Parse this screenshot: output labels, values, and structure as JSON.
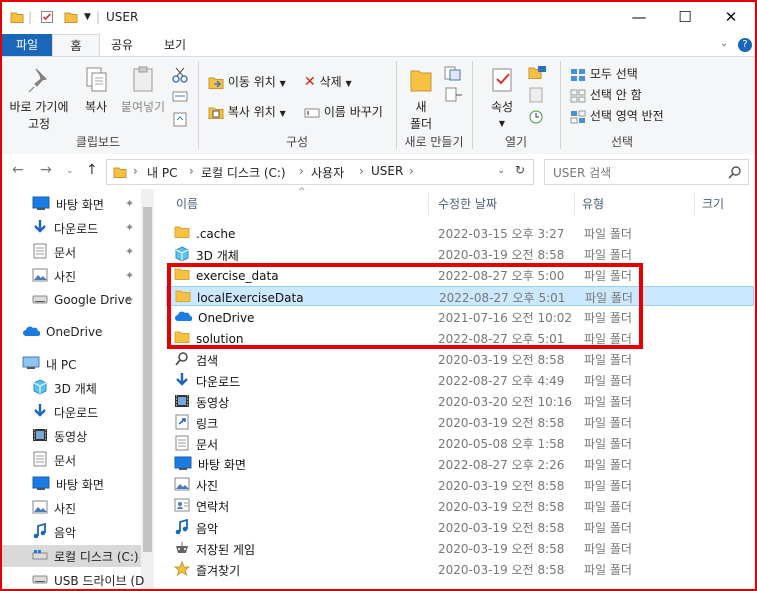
{
  "window": {
    "title": "USER",
    "controls": {
      "minimize": "—",
      "maximize": "☐",
      "close": "✕"
    }
  },
  "ribbon_tabs": [
    "파일",
    "홈",
    "공유",
    "보기"
  ],
  "ribbon": {
    "clipboard": {
      "pin_label_1": "바로 가기에",
      "pin_label_2": "고정",
      "copy": "복사",
      "paste": "붙여넣기",
      "label": "클립보드"
    },
    "organize": {
      "move_to": "이동 위치",
      "copy_to": "복사 위치",
      "delete": "삭제",
      "rename": "이름 바꾸기",
      "label": "구성"
    },
    "new": {
      "new_folder_1": "새",
      "new_folder_2": "폴더",
      "label": "새로 만들기"
    },
    "open": {
      "properties": "속성",
      "label": "열기"
    },
    "select": {
      "select_all": "모두 선택",
      "select_none": "선택 안 함",
      "invert": "선택 영역 반전",
      "label": "선택"
    }
  },
  "address": {
    "breadcrumb": [
      "내 PC",
      "로컬 디스크 (C:)",
      "사용자",
      "USER"
    ],
    "search_placeholder": "USER 검색"
  },
  "nav_pane": [
    {
      "label": "바탕 화면",
      "icon": "desktop-icon",
      "pinned": true
    },
    {
      "label": "다운로드",
      "icon": "download-icon",
      "pinned": true
    },
    {
      "label": "문서",
      "icon": "document-icon",
      "pinned": true
    },
    {
      "label": "사진",
      "icon": "pictures-icon",
      "pinned": true
    },
    {
      "label": "Google Drive",
      "icon": "drive-icon",
      "pinned": true
    },
    {
      "label": "OneDrive",
      "icon": "onedrive-icon",
      "pinned": false
    },
    {
      "label": "내 PC",
      "icon": "pc-icon",
      "pinned": false
    },
    {
      "label": "3D 개체",
      "icon": "3d-icon",
      "pinned": false
    },
    {
      "label": "다운로드",
      "icon": "download-icon",
      "pinned": false
    },
    {
      "label": "동영상",
      "icon": "video-icon",
      "pinned": false
    },
    {
      "label": "문서",
      "icon": "document-icon",
      "pinned": false
    },
    {
      "label": "바탕 화면",
      "icon": "desktop-icon",
      "pinned": false
    },
    {
      "label": "사진",
      "icon": "pictures-icon",
      "pinned": false
    },
    {
      "label": "음악",
      "icon": "music-icon",
      "pinned": false
    },
    {
      "label": "로컬 디스크 (C:)",
      "icon": "disk-icon",
      "pinned": false
    },
    {
      "label": "USB 드라이브 (D",
      "icon": "usb-icon",
      "pinned": false
    }
  ],
  "columns": [
    "이름",
    "수정한 날짜",
    "유형",
    "크기"
  ],
  "files": [
    {
      "name": ".cache",
      "date": "2022-03-15 오후 3:27",
      "type": "파일 폴더",
      "icon": "folder-icon"
    },
    {
      "name": "3D 개체",
      "date": "2020-03-19 오전 8:58",
      "type": "파일 폴더",
      "icon": "3d-icon"
    },
    {
      "name": "exercise_data",
      "date": "2022-08-27 오후 5:00",
      "type": "파일 폴더",
      "icon": "folder-icon"
    },
    {
      "name": "localExerciseData",
      "date": "2022-08-27 오후 5:01",
      "type": "파일 폴더",
      "icon": "folder-icon"
    },
    {
      "name": "OneDrive",
      "date": "2021-07-16 오전 10:02",
      "type": "파일 폴더",
      "icon": "onedrive-icon"
    },
    {
      "name": "solution",
      "date": "2022-08-27 오후 5:01",
      "type": "파일 폴더",
      "icon": "folder-icon"
    },
    {
      "name": "검색",
      "date": "2020-03-19 오전 8:58",
      "type": "파일 폴더",
      "icon": "search-icon"
    },
    {
      "name": "다운로드",
      "date": "2022-08-27 오후 4:49",
      "type": "파일 폴더",
      "icon": "download-icon"
    },
    {
      "name": "동영상",
      "date": "2020-03-20 오전 10:16",
      "type": "파일 폴더",
      "icon": "video-icon"
    },
    {
      "name": "링크",
      "date": "2020-03-19 오전 8:58",
      "type": "파일 폴더",
      "icon": "link-icon"
    },
    {
      "name": "문서",
      "date": "2020-05-08 오후 1:58",
      "type": "파일 폴더",
      "icon": "document-icon"
    },
    {
      "name": "바탕 화면",
      "date": "2022-08-27 오후 2:26",
      "type": "파일 폴더",
      "icon": "desktop-icon"
    },
    {
      "name": "사진",
      "date": "2020-03-19 오전 8:58",
      "type": "파일 폴더",
      "icon": "pictures-icon"
    },
    {
      "name": "연락처",
      "date": "2020-03-19 오전 8:58",
      "type": "파일 폴더",
      "icon": "contacts-icon"
    },
    {
      "name": "음악",
      "date": "2020-03-19 오전 8:58",
      "type": "파일 폴더",
      "icon": "music-icon"
    },
    {
      "name": "저장된 게임",
      "date": "2020-03-19 오전 8:58",
      "type": "파일 폴더",
      "icon": "saved-games-icon"
    },
    {
      "name": "즐겨찾기",
      "date": "2020-03-19 오전 8:58",
      "type": "파일 폴더",
      "icon": "favorites-icon"
    }
  ],
  "selected_file": "localExerciseData",
  "colors": {
    "accent": "#1a66b8",
    "selection": "#cce8ff",
    "highlight_border": "#e60000",
    "folder": "#f6c143"
  }
}
